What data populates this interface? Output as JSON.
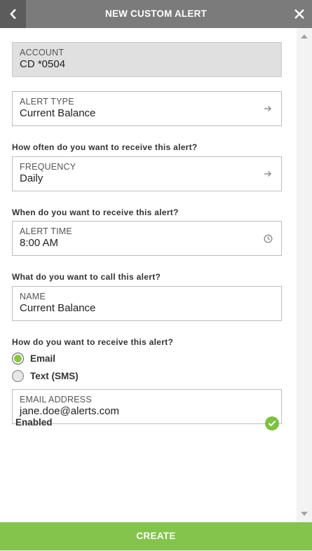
{
  "header": {
    "title": "NEW CUSTOM ALERT",
    "back_icon": "chevron-left-icon",
    "close_icon": "close-icon"
  },
  "account": {
    "label": "ACCOUNT",
    "value": "CD *0504"
  },
  "alert_type": {
    "label": "ALERT TYPE",
    "value": "Current Balance",
    "icon": "arrow-right-icon"
  },
  "frequency": {
    "question": "How often do you want to receive this alert?",
    "label": "FREQUENCY",
    "value": "Daily",
    "icon": "arrow-right-icon"
  },
  "alert_time": {
    "question": "When do you want to receive this alert?",
    "label": "ALERT TIME",
    "value": "8:00 AM",
    "icon": "clock-icon"
  },
  "name": {
    "question": "What do you want to call this alert?",
    "label": "NAME",
    "value": "Current Balance"
  },
  "delivery": {
    "question": "How do you want to receive this alert?",
    "options": [
      {
        "label": "Email",
        "selected": true
      },
      {
        "label": "Text (SMS)",
        "selected": false
      }
    ]
  },
  "email": {
    "label": "EMAIL ADDRESS",
    "value": "jane.doe@alerts.com"
  },
  "enabled": {
    "label": "Enabled",
    "checked": true,
    "icon": "check-circle-icon"
  },
  "footer": {
    "create_label": "CREATE"
  },
  "colors": {
    "accent": "#83c44c",
    "header_bg": "#7b7b7b",
    "back_bg": "#5c5c5c"
  }
}
